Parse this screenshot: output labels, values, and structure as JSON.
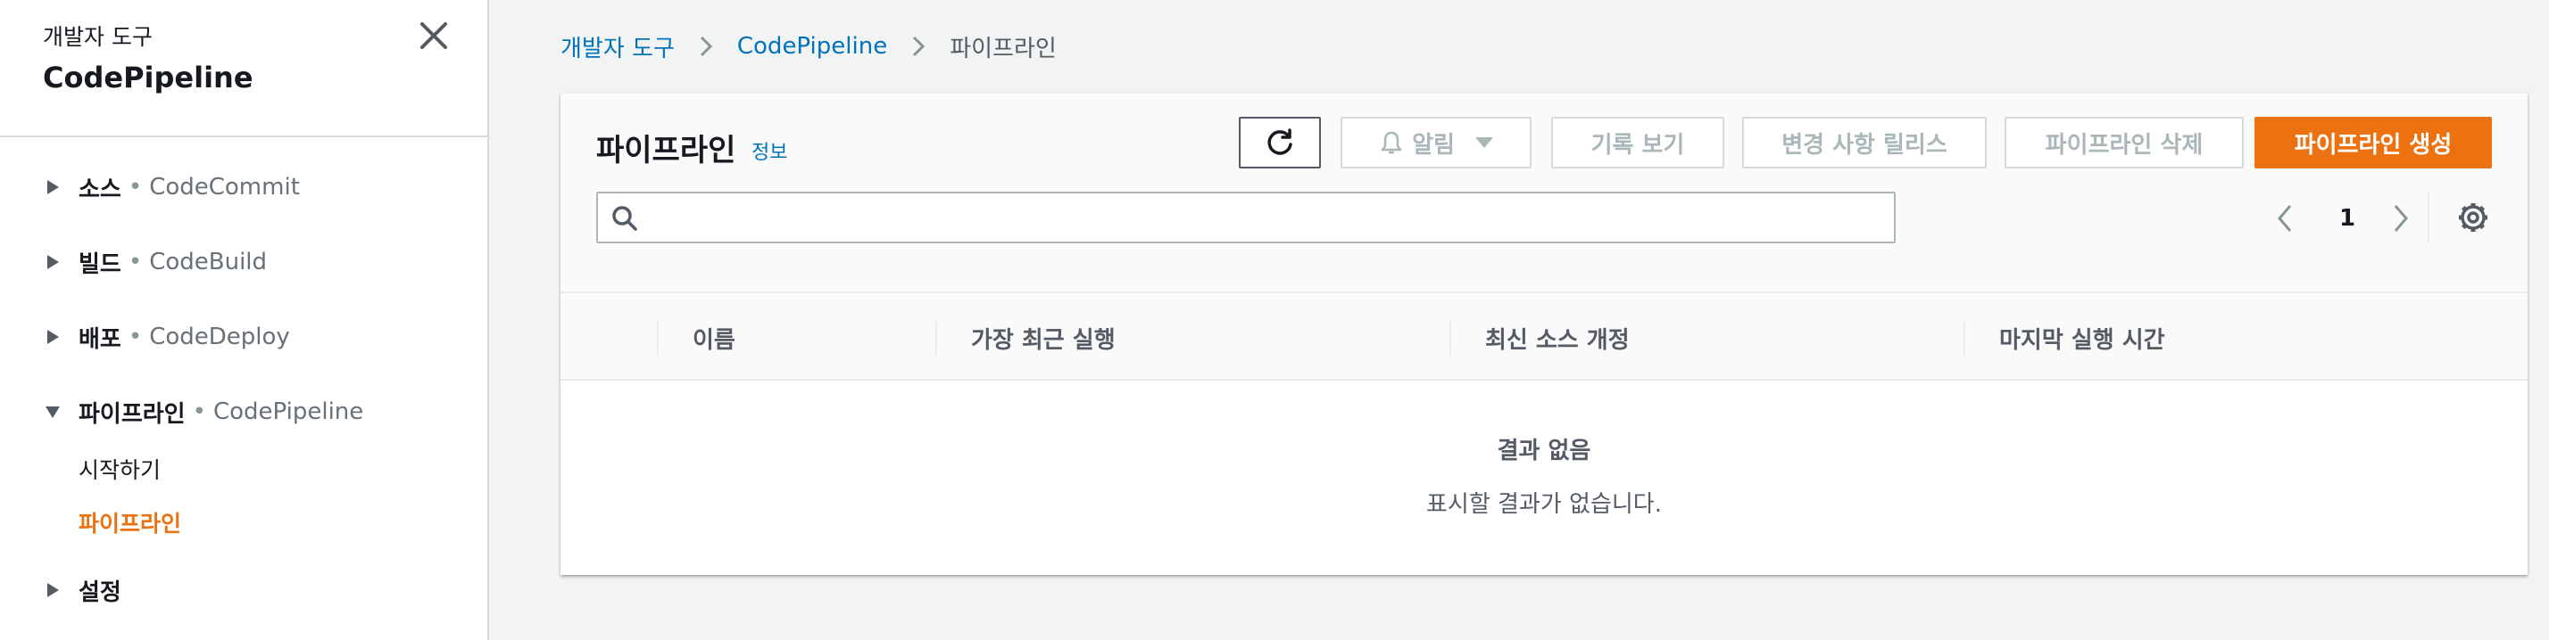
{
  "sidebar": {
    "subtitle": "개발자 도구",
    "title": "CodePipeline",
    "close_icon": "close-icon",
    "sections": [
      {
        "label": "소스",
        "service": "CodeCommit",
        "expanded": false
      },
      {
        "label": "빌드",
        "service": "CodeBuild",
        "expanded": false
      },
      {
        "label": "배포",
        "service": "CodeDeploy",
        "expanded": false
      },
      {
        "label": "파이프라인",
        "service": "CodePipeline",
        "expanded": true
      },
      {
        "label": "설정",
        "service": "",
        "expanded": false
      }
    ],
    "separator": "•",
    "sublinks": [
      {
        "label": "시작하기",
        "active": false
      },
      {
        "label": "파이프라인",
        "active": true
      }
    ]
  },
  "breadcrumb": {
    "items": [
      "개발자 도구",
      "CodePipeline",
      "파이프라인"
    ]
  },
  "panel": {
    "title": "파이프라인",
    "info_link": "정보",
    "buttons": {
      "refresh_icon": "refresh-icon",
      "notify": "알림",
      "history": "기록 보기",
      "release": "변경 사항 릴리스",
      "delete": "파이프라인 삭제",
      "create": "파이프라인 생성"
    },
    "search": {
      "value": "",
      "placeholder": ""
    },
    "pagination": {
      "current_page": "1"
    },
    "columns": [
      "이름",
      "가장 최근 실행",
      "최신 소스 개정",
      "마지막 실행 시간"
    ],
    "rows": [],
    "empty_title": "결과 없음",
    "empty_text": "표시할 결과가 없습니다."
  },
  "colors": {
    "accent": "#ec7211",
    "link": "#0073bb",
    "disabled_text": "#aab7b8",
    "border": "#d5dbdb",
    "page_bg": "#f2f3f3"
  }
}
